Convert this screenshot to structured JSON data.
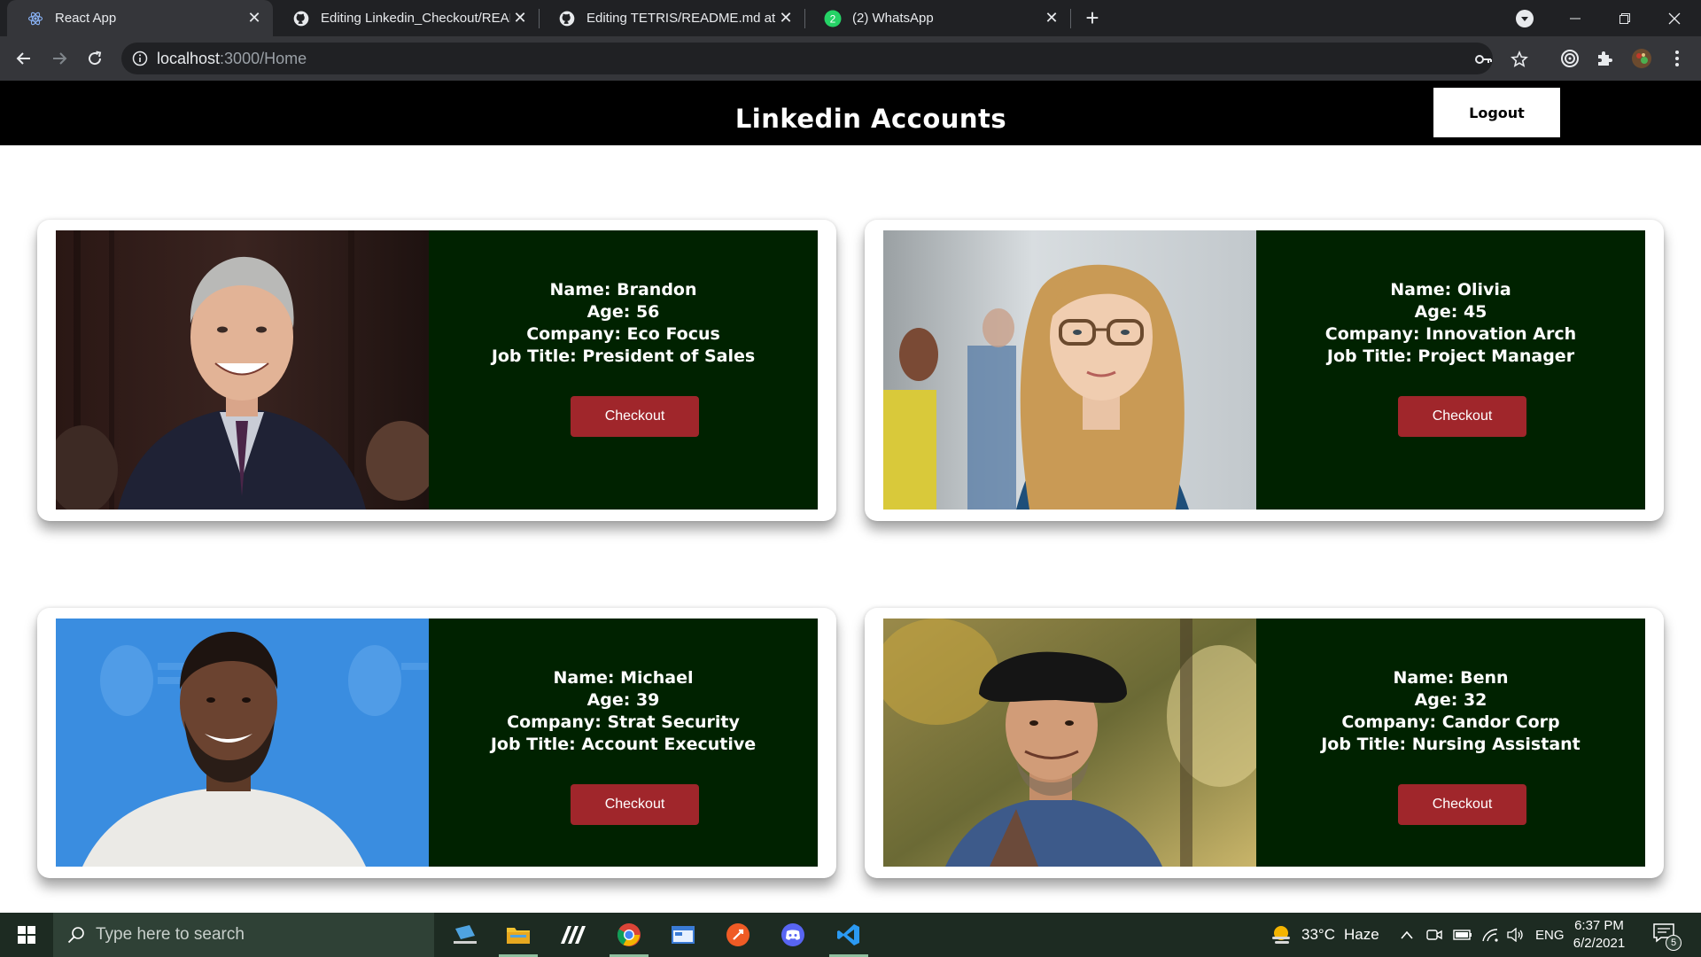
{
  "browser": {
    "tabs": [
      {
        "title": "React App",
        "active": true
      },
      {
        "title": "Editing Linkedin_Checkout/READ",
        "active": false
      },
      {
        "title": "Editing TETRIS/README.md at m",
        "active": false
      },
      {
        "title": "(2) WhatsApp",
        "active": false
      }
    ],
    "whatsapp_badge": "2",
    "new_tab_label": "+",
    "url_host": "localhost",
    "url_path": ":3000/Home"
  },
  "app": {
    "title": "Linkedin Accounts",
    "logout_label": "Logout",
    "accounts": [
      {
        "name_line": "Name: Brandon",
        "age_line": "Age: 56",
        "company_line": "Company: Eco Focus",
        "job_line": "Job Title: President of Sales",
        "checkout_label": "Checkout"
      },
      {
        "name_line": "Name: Olivia",
        "age_line": "Age: 45",
        "company_line": "Company: Innovation Arch",
        "job_line": "Job Title: Project Manager",
        "checkout_label": "Checkout"
      },
      {
        "name_line": "Name: Michael",
        "age_line": "Age: 39",
        "company_line": "Company: Strat Security",
        "job_line": "Job Title: Account Executive",
        "checkout_label": "Checkout"
      },
      {
        "name_line": "Name: Benn",
        "age_line": "Age: 32",
        "company_line": "Company: Candor Corp",
        "job_line": "Job Title: Nursing Assistant",
        "checkout_label": "Checkout"
      }
    ]
  },
  "taskbar": {
    "search_placeholder": "Type here to search",
    "weather_temp": "33°C",
    "weather_text": "Haze",
    "language": "ENG",
    "time": "6:37 PM",
    "date": "6/2/2021",
    "notification_count": "5"
  },
  "colors": {
    "info_panel_bg": "#002200",
    "checkout_bg": "#a0262b",
    "header_bg": "#000000",
    "taskbar_bg": "#1d2b22"
  }
}
